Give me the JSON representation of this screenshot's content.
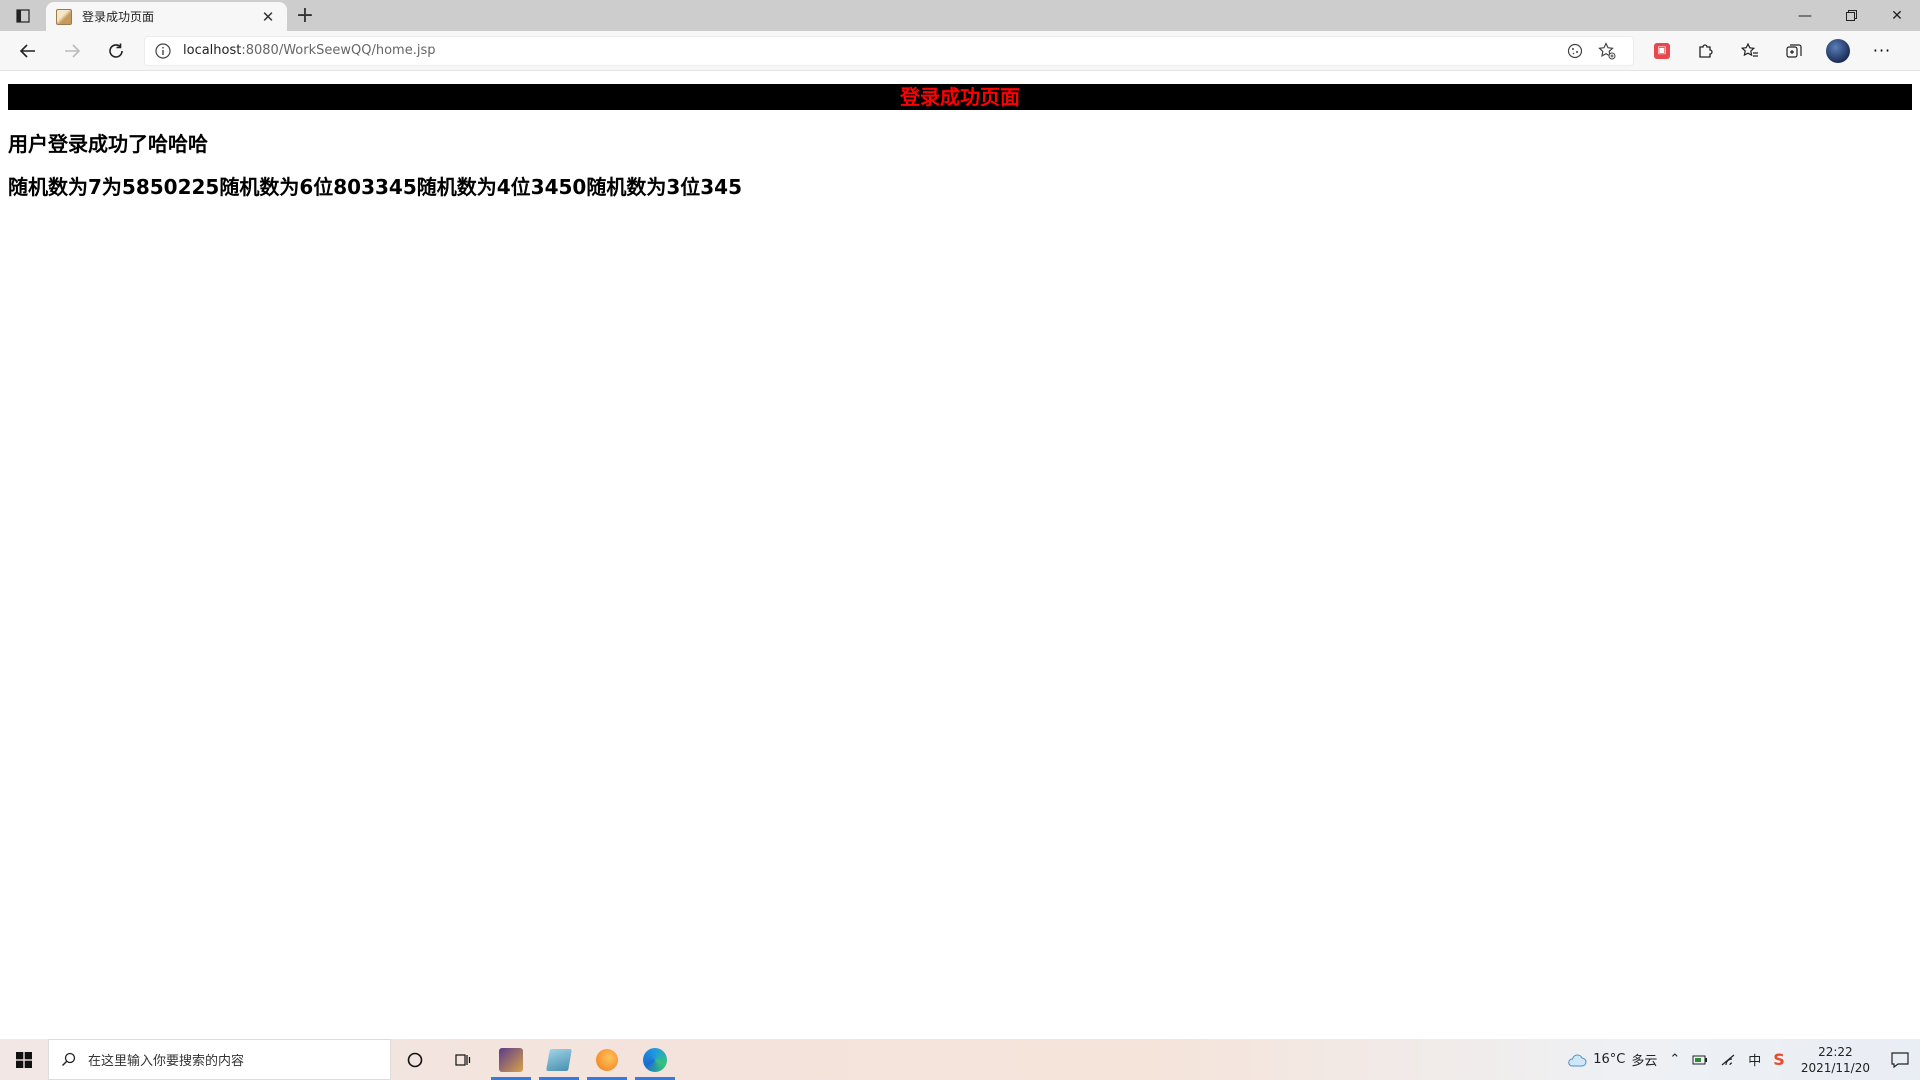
{
  "browser": {
    "tab_title": "登录成功页面",
    "url_host": "localhost",
    "url_rest": ":8080/WorkSeewQQ/home.jsp"
  },
  "page": {
    "banner_title": "登录成功页面",
    "success_message": "用户登录成功了哈哈哈",
    "random_message": "随机数为7为5850225随机数为6位803345随机数为4位3450随机数为3位345"
  },
  "taskbar": {
    "search_placeholder": "在这里输入你要搜索的内容",
    "weather_temp": "16°C",
    "weather_desc": "多云",
    "ime": "中",
    "time": "22:22",
    "date": "2021/11/20"
  },
  "colors": {
    "banner_bg": "#000000",
    "banner_text": "#ff0000"
  }
}
